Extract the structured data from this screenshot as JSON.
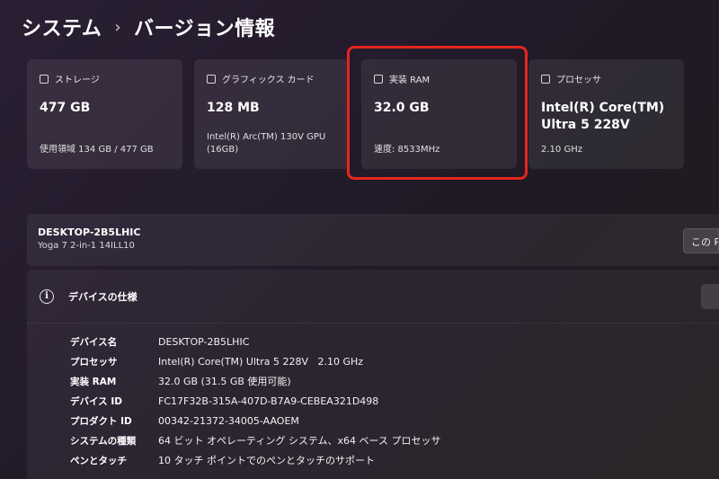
{
  "breadcrumb": {
    "parent": "システム",
    "separator": "›",
    "current": "バージョン情報"
  },
  "cards": [
    {
      "title": "ストレージ",
      "icon": "storage-icon",
      "value": "477 GB",
      "sub": "使用領域 134 GB / 477 GB"
    },
    {
      "title": "グラフィックス カード",
      "icon": "graphics-card-icon",
      "value": "128 MB",
      "sub": "Intel(R) Arc(TM) 130V GPU (16GB)"
    },
    {
      "title": "実装 RAM",
      "icon": "ram-icon",
      "value": "32.0 GB",
      "sub": "速度: 8533MHz"
    },
    {
      "title": "プロセッサ",
      "icon": "processor-icon",
      "value": "Intel(R) Core(TM) Ultra 5 228V",
      "sub": "2.10 GHz"
    }
  ],
  "highlight_color": "#e5261e",
  "device": {
    "name": "DESKTOP-2B5LHIC",
    "model": "Yoga 7 2-in-1 14ILL10",
    "rename_button": "この PC の名前を変更"
  },
  "specs": {
    "title": "デバイスの仕様",
    "rows": [
      {
        "key": "デバイス名",
        "value": "DESKTOP-2B5LHIC"
      },
      {
        "key": "プロセッサ",
        "value": "Intel(R) Core(TM) Ultra 5 228V   2.10 GHz"
      },
      {
        "key": "実装 RAM",
        "value": "32.0 GB (31.5 GB 使用可能)"
      },
      {
        "key": "デバイス ID",
        "value": "FC17F32B-315A-407D-B7A9-CEBEA321D498"
      },
      {
        "key": "プロダクト ID",
        "value": "00342-21372-34005-AAOEM"
      },
      {
        "key": "システムの種類",
        "value": "64 ビット オペレーティング システム、x64 ベース プロセッサ"
      },
      {
        "key": "ペンとタッチ",
        "value": "10 タッチ ポイントでのペンとタッチのサポート"
      }
    ]
  }
}
